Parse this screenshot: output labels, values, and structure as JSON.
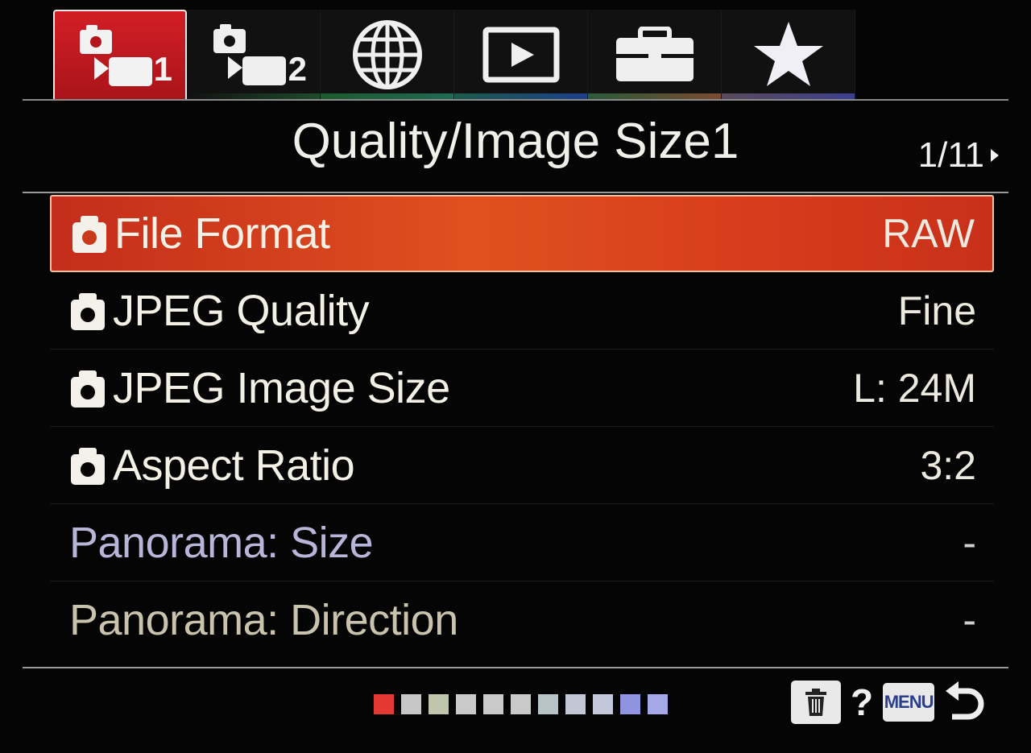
{
  "tabs": [
    {
      "icon": "camera-settings-1-icon",
      "number": "1",
      "active": true,
      "accent": "#d21e25"
    },
    {
      "icon": "camera-settings-2-icon",
      "number": "2",
      "active": false,
      "accent": "#1f5f2f"
    },
    {
      "icon": "network-globe-icon",
      "number": "",
      "active": false,
      "accent": "#1e6a3a"
    },
    {
      "icon": "playback-icon",
      "number": "",
      "active": false,
      "accent": "#1c4f8a"
    },
    {
      "icon": "setup-toolbox-icon",
      "number": "",
      "active": false,
      "accent": "#7a4c30"
    },
    {
      "icon": "my-menu-star-icon",
      "number": "",
      "active": false,
      "accent": "#3c3f8f"
    }
  ],
  "header": {
    "title": "Quality/Image Size1",
    "page_indicator": "1/11"
  },
  "menu": {
    "items": [
      {
        "label": "File Format",
        "value": "RAW",
        "has_camera_icon": true,
        "selected": true
      },
      {
        "label": "JPEG Quality",
        "value": "Fine",
        "has_camera_icon": true,
        "selected": false
      },
      {
        "label": "JPEG Image Size",
        "value": "L: 24M",
        "has_camera_icon": true,
        "selected": false
      },
      {
        "label": "Aspect Ratio",
        "value": "3:2",
        "has_camera_icon": true,
        "selected": false
      },
      {
        "label": "Panorama: Size",
        "value": "-",
        "has_camera_icon": false,
        "selected": false
      },
      {
        "label": "Panorama: Direction",
        "value": "-",
        "has_camera_icon": false,
        "selected": false
      }
    ]
  },
  "footer": {
    "page_squares": [
      "#e23a33",
      "#c7c7c7",
      "#bfc6ab",
      "#c9c9c9",
      "#c9c9c9",
      "#c9c9c9",
      "#b8c3c7",
      "#c2c7d6",
      "#c2c8da",
      "#8f93e0",
      "#a5a8e6"
    ],
    "trash_icon": "trash-icon",
    "help_label": "?",
    "menu_label": "MENU",
    "back_icon": "back-arrow-icon"
  },
  "colors": {
    "selection": "#d8431d",
    "active_tab": "#d21e25",
    "background": "#050505"
  }
}
